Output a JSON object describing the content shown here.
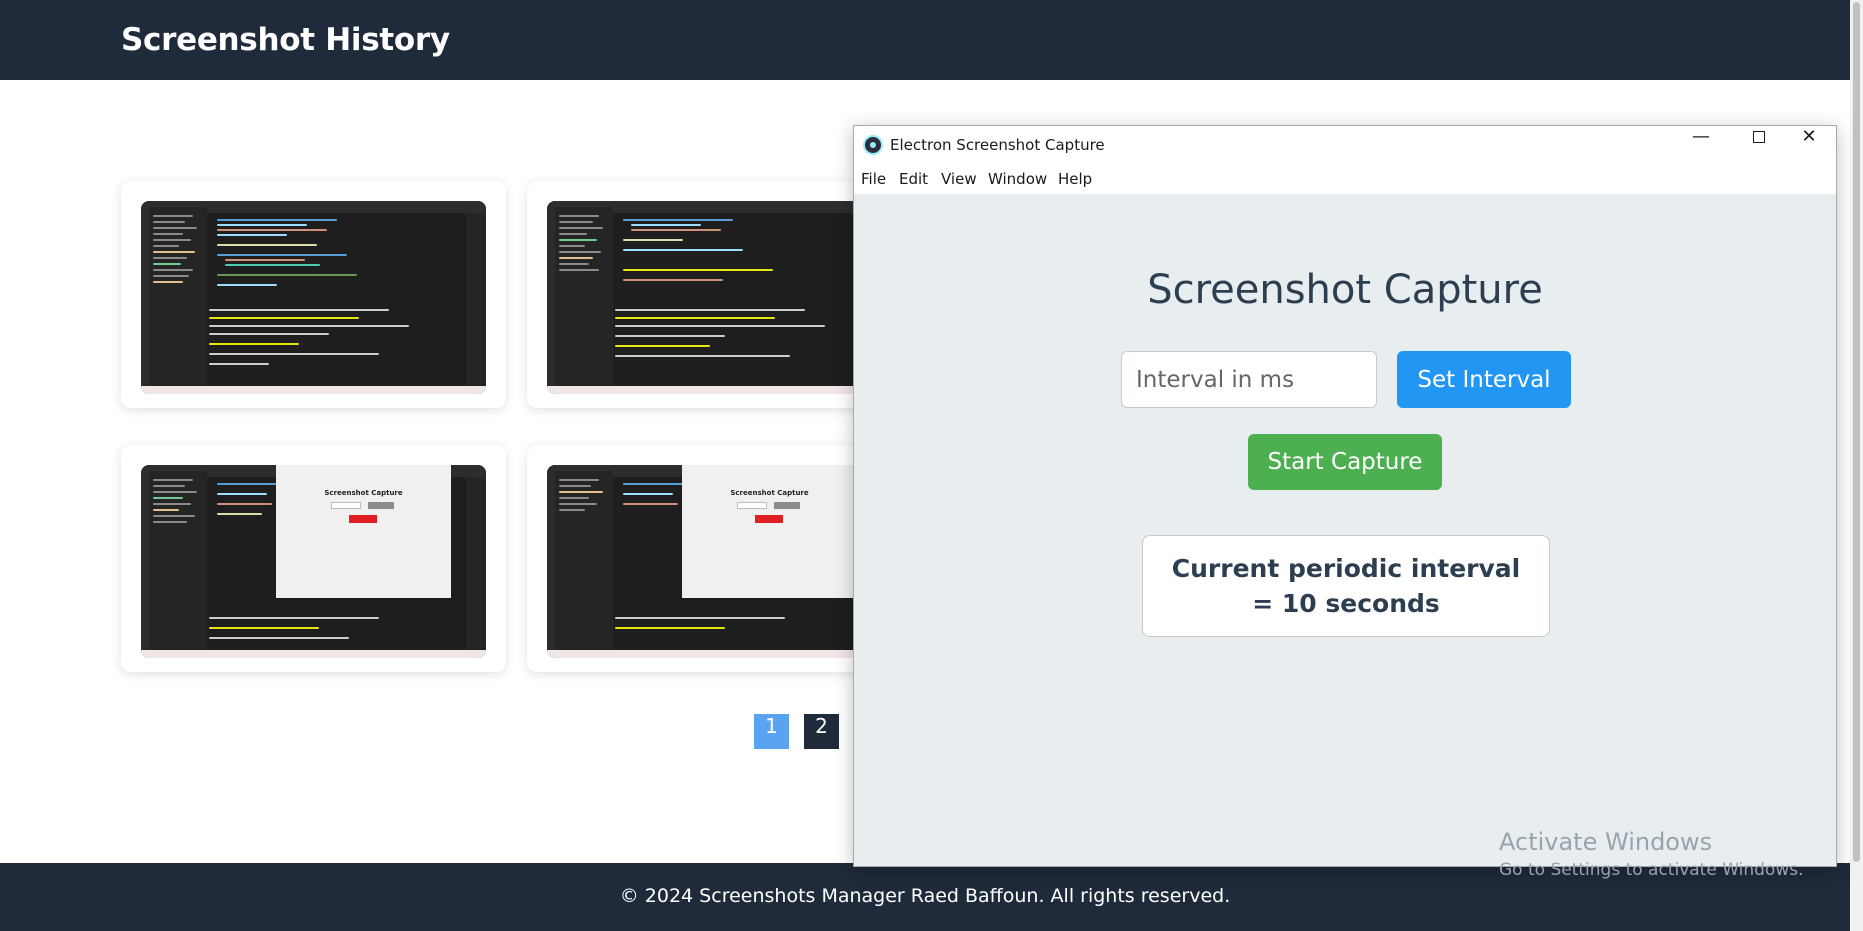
{
  "site": {
    "title": "Screenshot History",
    "footer": "© 2024 Screenshots Manager Raed Baffoun. All rights reserved.",
    "pagination": [
      "1",
      "2"
    ],
    "active_page": "1"
  },
  "thumbnails": {
    "mini_app_title": "Screenshot Capture"
  },
  "app_window": {
    "title": "Electron Screenshot Capture",
    "controls": {
      "minimize": "—",
      "close": "✕"
    },
    "menu": [
      "File",
      "Edit",
      "View",
      "Window",
      "Help"
    ],
    "heading": "Screenshot Capture",
    "interval_placeholder": "Interval in ms",
    "interval_value": "",
    "set_interval_label": "Set Interval",
    "start_capture_label": "Start Capture",
    "status": "Current periodic interval = 10 seconds"
  },
  "watermark": {
    "line1": "Activate Windows",
    "line2": "Go to Settings to activate Windows."
  },
  "colors": {
    "header_bg": "#1f2a3a",
    "set_interval_btn": "#2196f3",
    "start_capture_btn": "#4caf50",
    "active_page": "#5aa3f0"
  }
}
